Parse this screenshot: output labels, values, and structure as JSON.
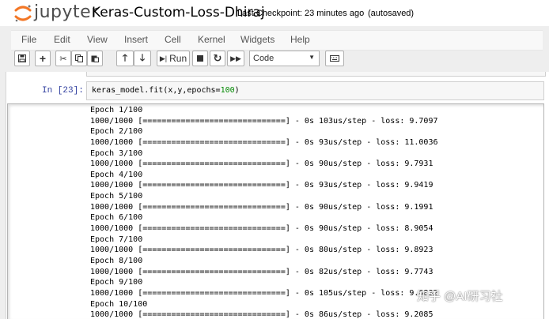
{
  "header": {
    "brand": "jupyter",
    "notebook_name": "Keras-Custom-Loss-Dhiraj",
    "checkpoint": "Last Checkpoint: 23 minutes ago",
    "save_status": "(autosaved)"
  },
  "menu": {
    "items": [
      "File",
      "Edit",
      "View",
      "Insert",
      "Cell",
      "Kernel",
      "Widgets",
      "Help"
    ]
  },
  "toolbar": {
    "run_label": "Run",
    "cell_type": "Code"
  },
  "cell": {
    "prompt": "In [23]:",
    "code_before": "keras_model.fit(x,y,epochs=",
    "code_number": "100",
    "code_after": ")"
  },
  "output": {
    "lines": [
      "Epoch 1/100",
      "1000/1000 [==============================] - 0s 103us/step - loss: 9.7097",
      "Epoch 2/100",
      "1000/1000 [==============================] - 0s 93us/step - loss: 11.0036",
      "Epoch 3/100",
      "1000/1000 [==============================] - 0s 90us/step - loss: 9.7931",
      "Epoch 4/100",
      "1000/1000 [==============================] - 0s 93us/step - loss: 9.9419",
      "Epoch 5/100",
      "1000/1000 [==============================] - 0s 90us/step - loss: 9.1991",
      "Epoch 6/100",
      "1000/1000 [==============================] - 0s 90us/step - loss: 8.9054",
      "Epoch 7/100",
      "1000/1000 [==============================] - 0s 80us/step - loss: 9.8923",
      "Epoch 8/100",
      "1000/1000 [==============================] - 0s 82us/step - loss: 9.7743",
      "Epoch 9/100",
      "1000/1000 [==============================] - 0s 105us/step - loss: 9.6832",
      "Epoch 10/100",
      "1000/1000 [==============================] - 0s 86us/step - loss: 9.2085"
    ]
  },
  "watermark": "知乎 @AI研习社"
}
